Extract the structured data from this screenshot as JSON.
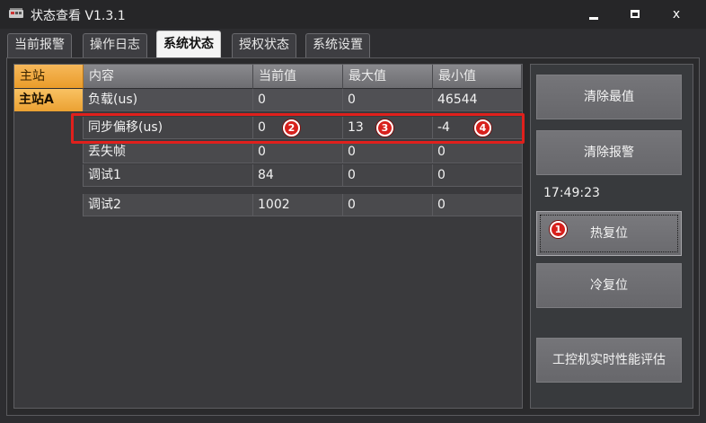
{
  "window": {
    "title": "状态查看 V1.3.1",
    "min_label": "",
    "close_label": "x"
  },
  "tabs": [
    {
      "label": "当前报警"
    },
    {
      "label": "操作日志"
    },
    {
      "label": "系统状态"
    },
    {
      "label": "授权状态"
    },
    {
      "label": "系统设置"
    }
  ],
  "active_tab_index": 2,
  "grid": {
    "headers": {
      "station": "主站",
      "content": "内容",
      "current": "当前值",
      "max": "最大值",
      "min": "最小值"
    },
    "rows": [
      {
        "station": "主站A",
        "content": "负载(us)",
        "current": "0",
        "max": "0",
        "min": "46544"
      },
      {
        "station": "",
        "content": "同步偏移(us)",
        "current": "0",
        "max": "13",
        "min": "-4"
      },
      {
        "station": "",
        "content": "丢失帧",
        "current": "0",
        "max": "0",
        "min": "0"
      },
      {
        "station": "",
        "content": "调试1",
        "current": "84",
        "max": "0",
        "min": "0"
      },
      {
        "station": "",
        "content": "调试2",
        "current": "1002",
        "max": "0",
        "min": "0"
      }
    ]
  },
  "markers": [
    "1",
    "2",
    "3",
    "4"
  ],
  "panel": {
    "clear_max": "清除最值",
    "clear_alarm": "清除报警",
    "time": "17:49:23",
    "hot_reset": "热复位",
    "cold_reset": "冷复位",
    "perf_eval": "工控机实时性能评估"
  },
  "colors": {
    "accent_orange": "#ea9c2a",
    "highlight_red": "#e0201c",
    "background": "#2d2d30"
  }
}
